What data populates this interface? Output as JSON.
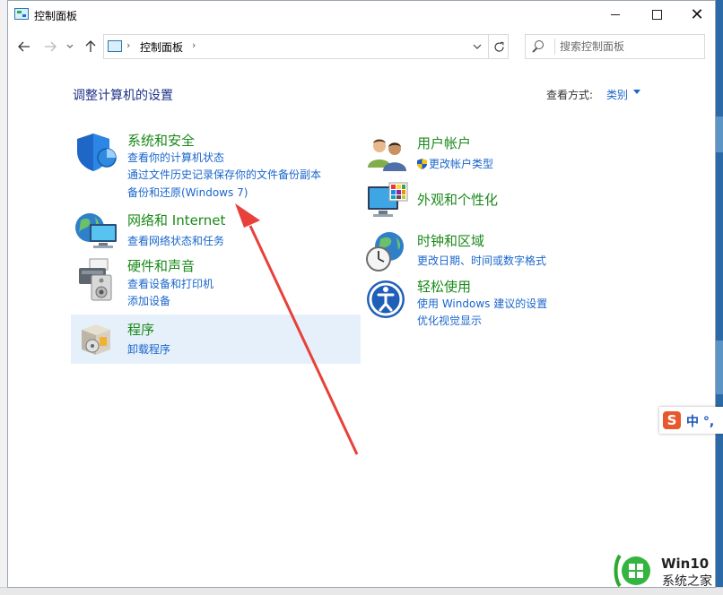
{
  "window": {
    "title": "控制面板",
    "controls": {
      "minimize": "—",
      "maximize": "☐",
      "close": "✕"
    }
  },
  "address": {
    "breadcrumb": "控制面板",
    "separator": "›"
  },
  "search": {
    "placeholder": "搜索控制面板"
  },
  "heading": "调整计算机的设置",
  "view_by": {
    "label": "查看方式:",
    "value": "类别"
  },
  "categories_left": [
    {
      "title": "系统和安全",
      "icon": "shield-icon",
      "links": [
        "查看你的计算机状态",
        "通过文件历史记录保存你的文件备份副本",
        "备份和还原(Windows 7)"
      ]
    },
    {
      "title": "网络和 Internet",
      "icon": "network-globe-icon",
      "links": [
        "查看网络状态和任务"
      ]
    },
    {
      "title": "硬件和声音",
      "icon": "printer-speaker-icon",
      "links": [
        "查看设备和打印机",
        "添加设备"
      ]
    },
    {
      "title": "程序",
      "icon": "programs-box-icon",
      "links": [
        "卸载程序"
      ]
    }
  ],
  "categories_right": [
    {
      "title": "用户帐户",
      "icon": "users-icon",
      "links": [
        "更改帐户类型"
      ]
    },
    {
      "title": "外观和个性化",
      "icon": "monitor-palette-icon",
      "links": []
    },
    {
      "title": "时钟和区域",
      "icon": "clock-globe-icon",
      "links": [
        "更改日期、时间或数字格式"
      ]
    },
    {
      "title": "轻松使用",
      "icon": "ease-of-access-icon",
      "links": [
        "使用 Windows 建议的设置",
        "优化视觉显示"
      ]
    }
  ],
  "ime": {
    "logo": "S",
    "text": "中 °,"
  },
  "watermark": {
    "line1": "Win10",
    "line2": "系统之家"
  },
  "colors": {
    "heading": "#1e3287",
    "category_title": "#1a8a1a",
    "link": "#1a66cc",
    "highlight": "#e6f0fa",
    "annotation_arrow": "#e8403a"
  }
}
